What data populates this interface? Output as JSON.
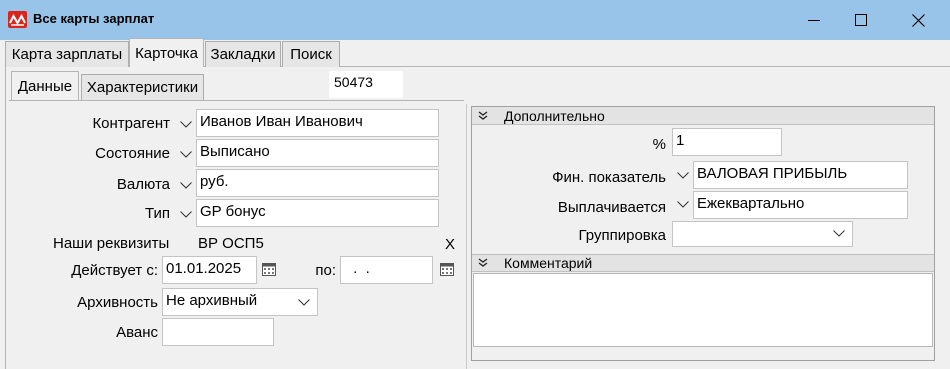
{
  "window": {
    "title": "Все карты зарплат",
    "accent": "#99c4ea",
    "icon": "app-logo-icon"
  },
  "tabs": [
    {
      "label": "Карта зарплаты",
      "active": false
    },
    {
      "label": "Карточка",
      "active": true
    },
    {
      "label": "Закладки",
      "active": false
    },
    {
      "label": "Поиск",
      "active": false
    }
  ],
  "subtabs": [
    {
      "label": "Данные",
      "active": true
    },
    {
      "label": "Характеристики",
      "active": false
    }
  ],
  "card_number": "50473",
  "form": {
    "counterparty": {
      "label": "Контрагент",
      "value": "Иванов Иван Иванович"
    },
    "state": {
      "label": "Состояние",
      "value": "Выписано"
    },
    "currency": {
      "label": "Валюта",
      "value": "руб."
    },
    "type": {
      "label": "Тип",
      "value": "GP бонус"
    },
    "requisites": {
      "label": "Наши реквизиты",
      "value": "ВР ОСП5",
      "clear": "Х"
    },
    "valid_from": {
      "label": "Действует с:",
      "value": "01.01.2025"
    },
    "valid_to": {
      "label": "по:",
      "value": " .  ."
    },
    "archive": {
      "label": "Архивность",
      "value": "Не архивный"
    },
    "advance": {
      "label": "Аванс",
      "value": ""
    }
  },
  "additional": {
    "title": "Дополнительно",
    "percent": {
      "label": "%",
      "value": "1"
    },
    "fin_indicator": {
      "label": "Фин. показатель",
      "value": "ВАЛОВАЯ ПРИБЫЛЬ"
    },
    "payment": {
      "label": "Выплачивается",
      "value": "Ежеквартально"
    },
    "grouping": {
      "label": "Группировка",
      "value": ""
    }
  },
  "comment": {
    "title": "Комментарий",
    "value": ""
  }
}
